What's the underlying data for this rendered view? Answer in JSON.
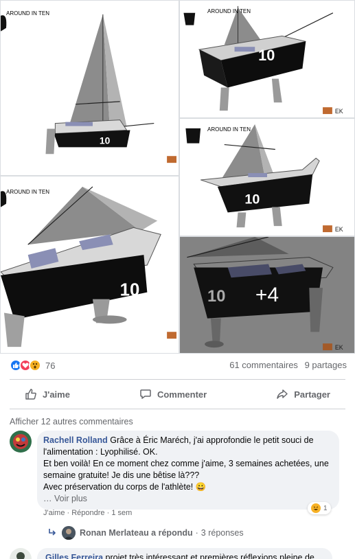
{
  "gallery": {
    "tiles": [
      {
        "caption": "AROUND IN TEN"
      },
      {
        "caption": "AROUND IN TEN"
      },
      {
        "caption": "AROUND IN TEN"
      },
      {
        "caption": "AROUND IN TEN"
      },
      {
        "caption": ""
      }
    ],
    "more_count": "+4"
  },
  "post_stats": {
    "reaction_count": "76",
    "comments": "61 commentaires",
    "shares": "9 partages"
  },
  "actions": {
    "like": "J'aime",
    "comment": "Commenter",
    "share": "Partager"
  },
  "comments_section": {
    "more_comments": "Afficher 12 autres commentaires",
    "comment1": {
      "author": "Rachell Rolland",
      "text_line1": " Grâce à Éric Maréch, j'ai approfondie le petit souci de l'alimentation : Lyophilisé. OK.",
      "text_line2": "Et ben voilà! En ce moment chez comme j'aime, 3 semaines achetées, une semaine gratuite! Je dis une bêtise là???",
      "text_line3": "Avec préservation du corps de l'athlète! 😀",
      "see_more": "… Voir plus",
      "like": "J'aime",
      "reply": "Répondre",
      "time": "1 sem",
      "reaction_count": "1"
    },
    "reply_summary": {
      "author": "Ronan Merlateau a répondu",
      "count": "3 réponses"
    },
    "comment2": {
      "author": "Gilles Ferreira",
      "text": " projet très intéressant et premières réflexions pleine de"
    }
  }
}
